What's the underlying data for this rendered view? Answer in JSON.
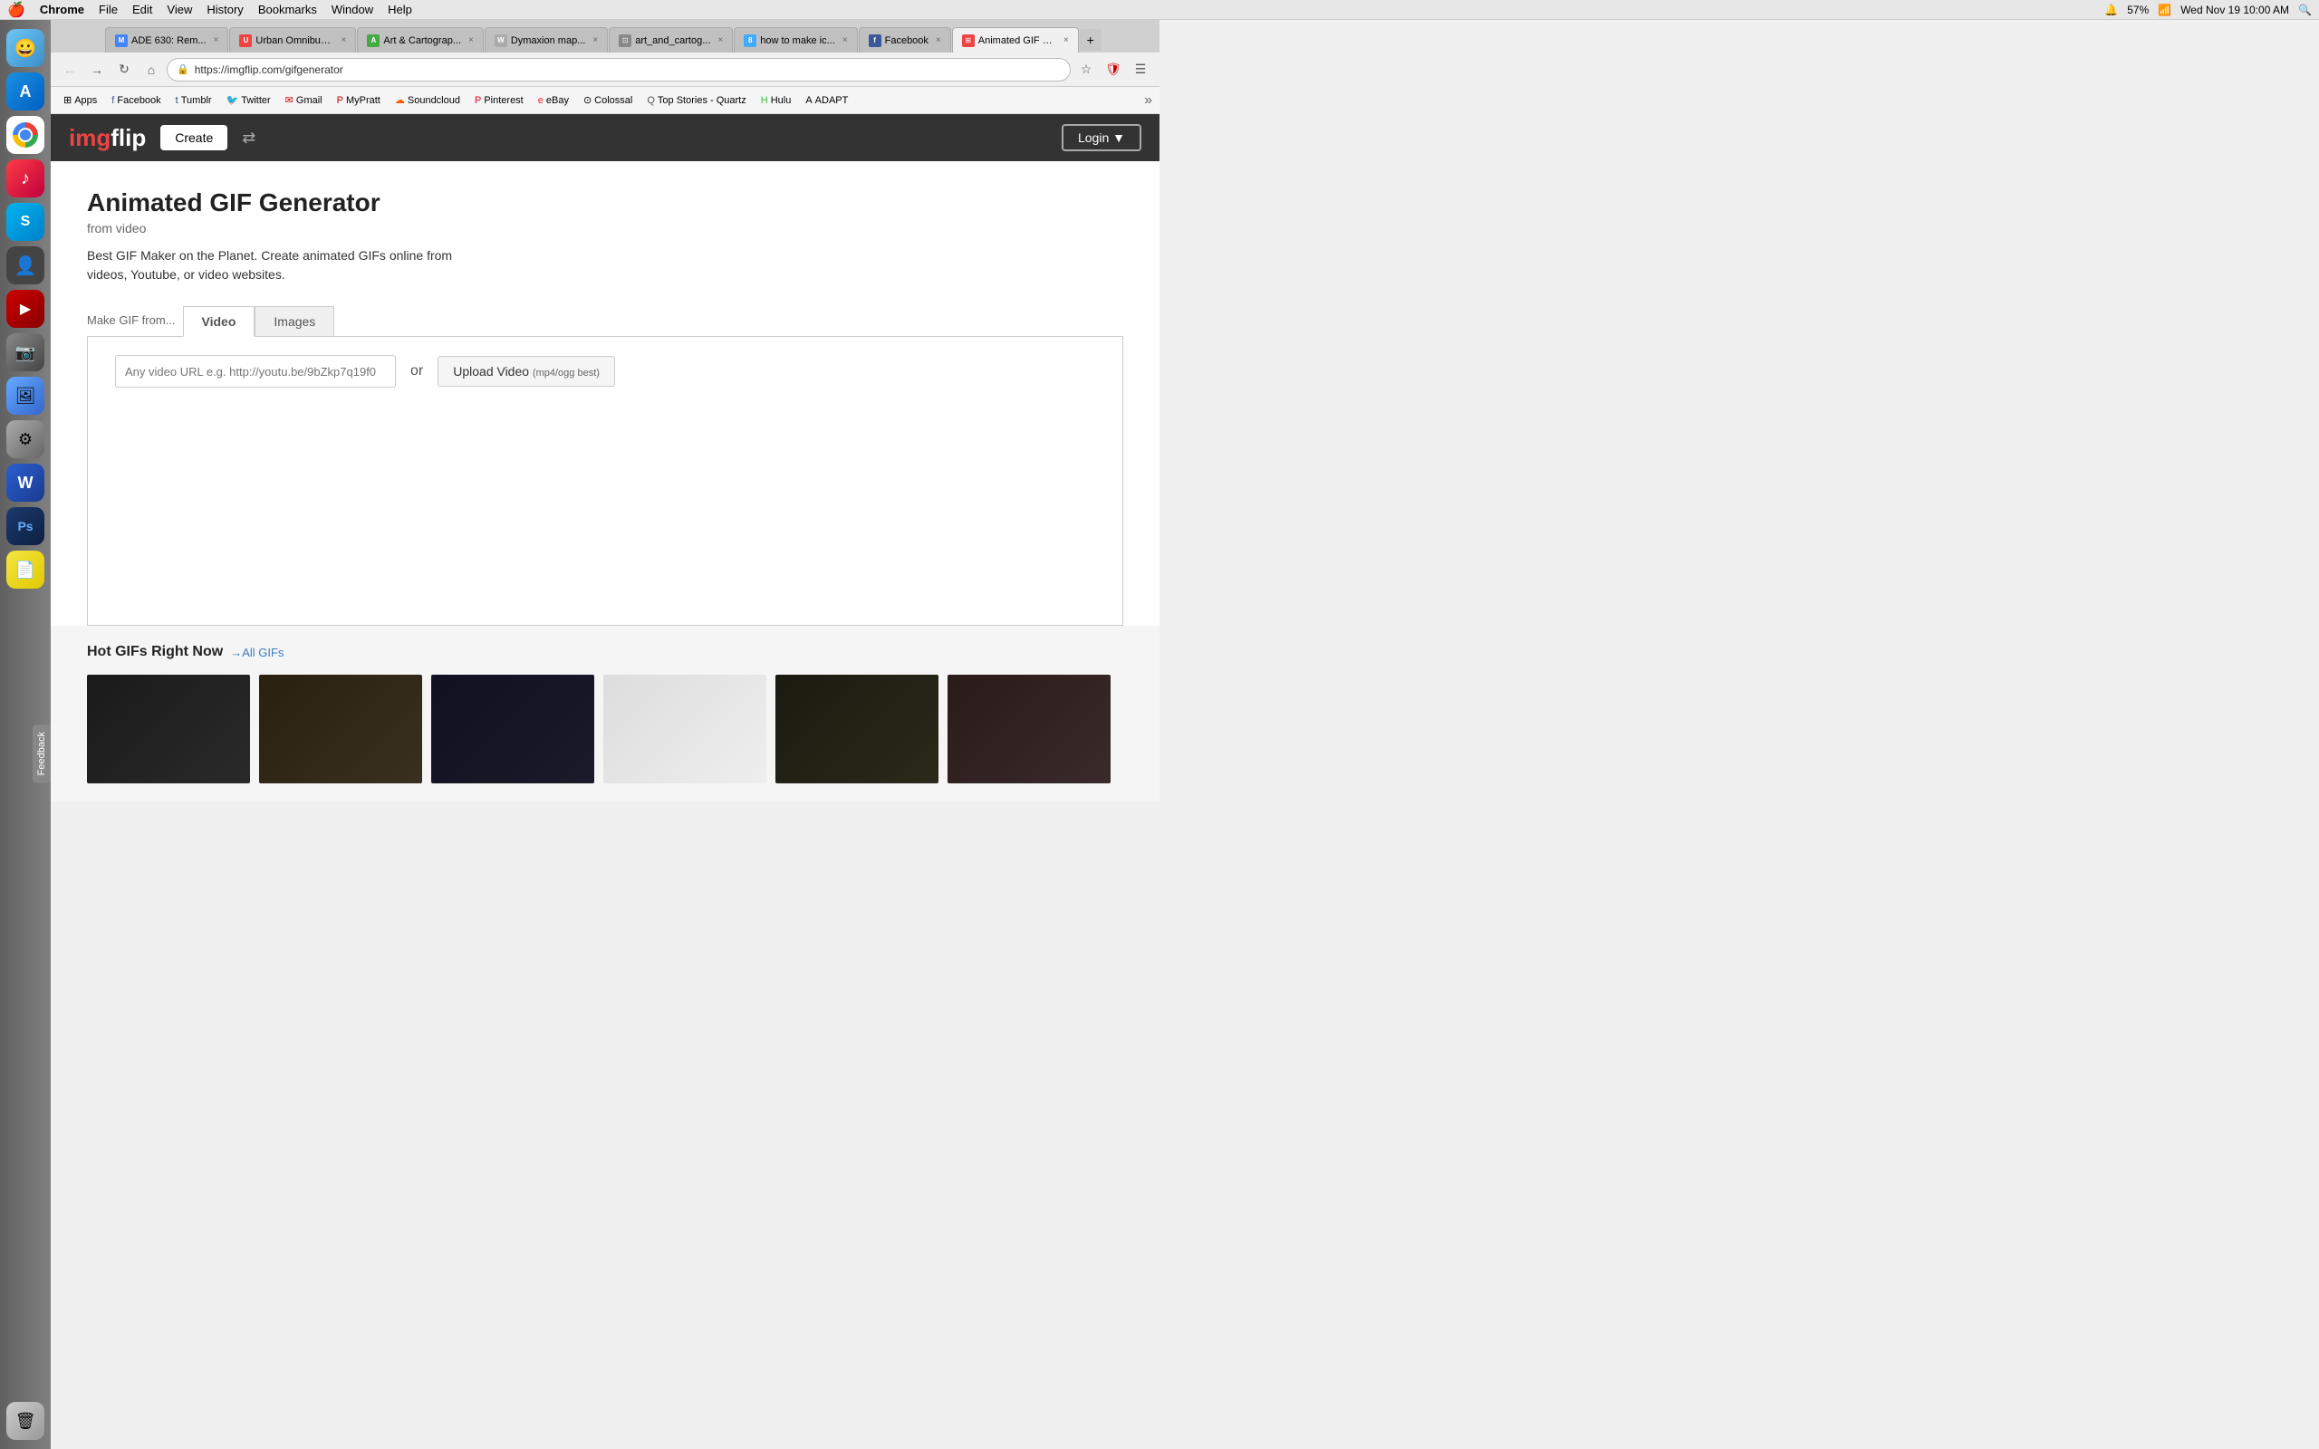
{
  "menubar": {
    "apple": "⌘",
    "items": [
      "Chrome",
      "File",
      "Edit",
      "View",
      "History",
      "Bookmarks",
      "Window",
      "Help"
    ],
    "right": {
      "battery": "57%",
      "time": "Wed Nov 19  10:00 AM"
    }
  },
  "tabs": [
    {
      "id": "tab-ade",
      "label": "ADE 630: Rem...",
      "favicon": "✉",
      "active": false
    },
    {
      "id": "tab-urban",
      "label": "Urban Omnibus...",
      "favicon": "U",
      "active": false
    },
    {
      "id": "tab-art",
      "label": "Art & Cartograp...",
      "favicon": "A",
      "active": false
    },
    {
      "id": "tab-dymaxion",
      "label": "Dymaxion map...",
      "favicon": "W",
      "active": false
    },
    {
      "id": "tab-artcarto2",
      "label": "art_and_cartog...",
      "favicon": "⊡",
      "active": false
    },
    {
      "id": "tab-howtomake",
      "label": "how to make ic...",
      "favicon": "8",
      "active": false
    },
    {
      "id": "tab-facebook",
      "label": "Facebook",
      "favicon": "f",
      "active": false
    },
    {
      "id": "tab-animgif",
      "label": "Animated GIF C...",
      "favicon": "⊞",
      "active": true
    }
  ],
  "navbar": {
    "url": "https://imgflip.com/gifgenerator",
    "back_title": "Back",
    "forward_title": "Forward",
    "refresh_title": "Refresh",
    "home_title": "Home"
  },
  "bookmarks": [
    {
      "id": "bm-apps",
      "label": "Apps",
      "icon": "⊞"
    },
    {
      "id": "bm-facebook",
      "label": "Facebook",
      "icon": "f"
    },
    {
      "id": "bm-tumblr",
      "label": "Tumblr",
      "icon": "t"
    },
    {
      "id": "bm-twitter",
      "label": "Twitter",
      "icon": "🐦"
    },
    {
      "id": "bm-gmail",
      "label": "Gmail",
      "icon": "✉"
    },
    {
      "id": "bm-mypratt",
      "label": "MyPratt",
      "icon": "P"
    },
    {
      "id": "bm-soundcloud",
      "label": "Soundcloud",
      "icon": "☁"
    },
    {
      "id": "bm-pinterest",
      "label": "Pinterest",
      "icon": "P"
    },
    {
      "id": "bm-ebay",
      "label": "eBay",
      "icon": "e"
    },
    {
      "id": "bm-colossal",
      "label": "Colossal",
      "icon": "⊙"
    },
    {
      "id": "bm-topstories",
      "label": "Top Stories - Quartz",
      "icon": "Q"
    },
    {
      "id": "bm-hulu",
      "label": "Hulu",
      "icon": "H"
    },
    {
      "id": "bm-adapt",
      "label": "ADAPT",
      "icon": "A"
    }
  ],
  "imgflip": {
    "logo_text": "imgflip",
    "logo_colored": "img",
    "create_btn": "Create",
    "login_btn": "Login ▼"
  },
  "page": {
    "title": "Animated GIF Generator",
    "subtitle": "from video",
    "description": "Best GIF Maker on the Planet. Create animated GIFs online from videos, Youtube, or video websites.",
    "tabs": {
      "label": "Make GIF from...",
      "items": [
        "Video",
        "Images"
      ],
      "active": "Video"
    },
    "video_input_placeholder": "Any video URL e.g. http://youtu.be/9bZkp7q19f0",
    "or_text": "or",
    "upload_btn": "Upload Video",
    "upload_btn_sub": "(mp4/ogg best)"
  },
  "hot_gifs": {
    "title": "Hot GIFs Right Now",
    "all_link": "→All GIFs"
  },
  "feedback": {
    "label": "Feedback"
  },
  "dock": {
    "items": [
      {
        "id": "finder",
        "icon": "🔍"
      },
      {
        "id": "appstore",
        "icon": "A"
      },
      {
        "id": "chrome",
        "icon": ""
      },
      {
        "id": "music",
        "icon": "♪"
      },
      {
        "id": "skype",
        "icon": "S"
      },
      {
        "id": "dark1",
        "icon": "👤"
      },
      {
        "id": "red",
        "icon": "🎮"
      },
      {
        "id": "camera",
        "icon": "📷"
      },
      {
        "id": "camera2",
        "icon": "🖼"
      },
      {
        "id": "system",
        "icon": "⚙"
      },
      {
        "id": "word",
        "icon": "W"
      },
      {
        "id": "ps",
        "icon": "Ps"
      },
      {
        "id": "notes",
        "icon": "📄"
      },
      {
        "id": "trash",
        "icon": "🗑"
      }
    ]
  }
}
